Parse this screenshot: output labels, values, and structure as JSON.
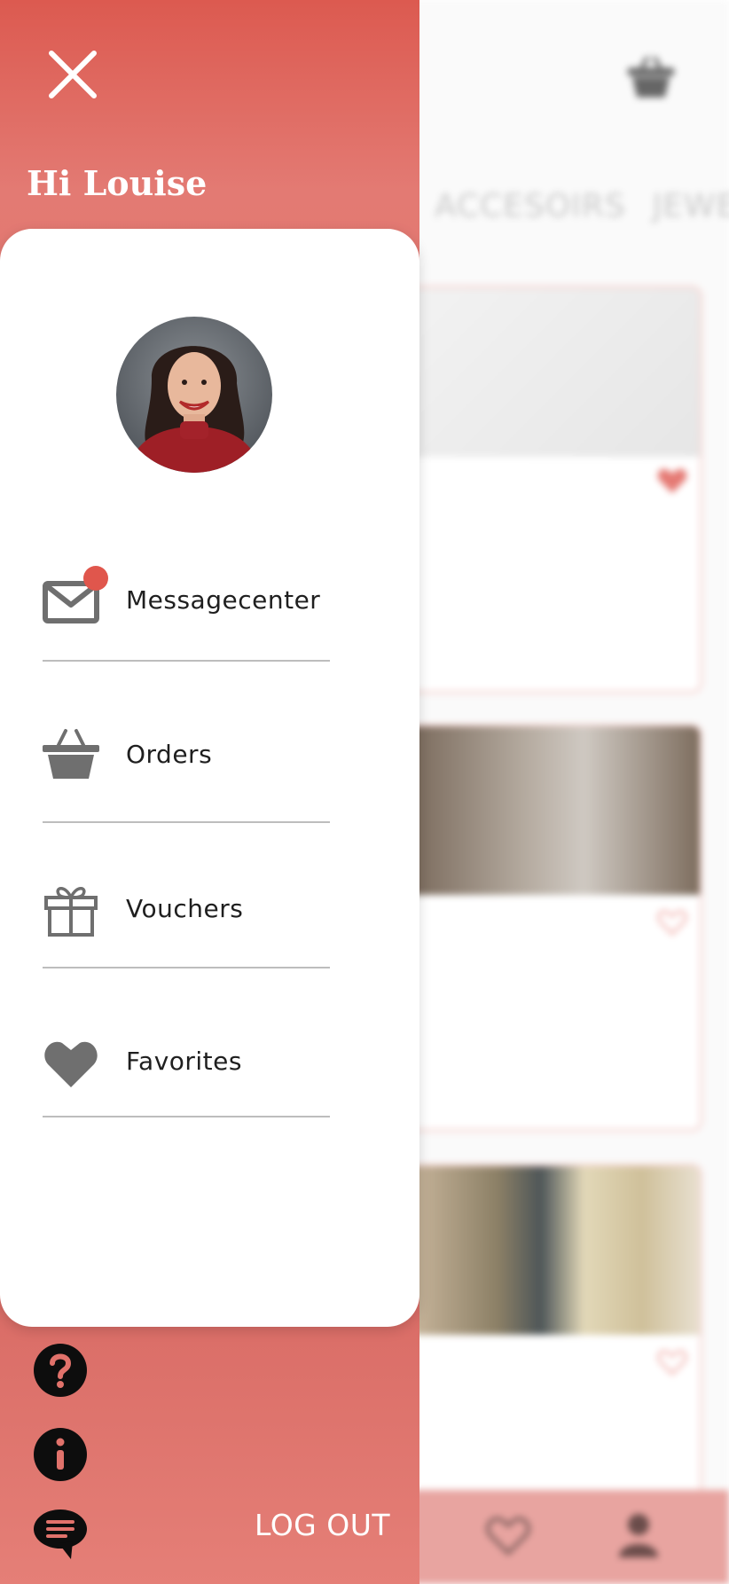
{
  "drawer": {
    "greeting": "Hi Louise",
    "menu": [
      {
        "id": "messagecenter",
        "label": "Messagecenter",
        "icon": "envelope-icon",
        "has_badge": true
      },
      {
        "id": "orders",
        "label": "Orders",
        "icon": "basket-icon"
      },
      {
        "id": "vouchers",
        "label": "Vouchers",
        "icon": "gift-icon"
      },
      {
        "id": "favorites",
        "label": "Favorites",
        "icon": "heart-icon"
      }
    ],
    "bottom_buttons": [
      "help-icon",
      "info-icon",
      "chat-icon"
    ],
    "logout_label": "LOG OUT"
  },
  "background": {
    "tabs": [
      "ACCESOIRS",
      "JEWEL"
    ]
  },
  "colors": {
    "drawer_top": "#dc5a50",
    "drawer_mid": "#e1726b",
    "badge": "#e0564c",
    "icon_gray": "#6f6f6f",
    "divider": "#bdbdbd"
  }
}
